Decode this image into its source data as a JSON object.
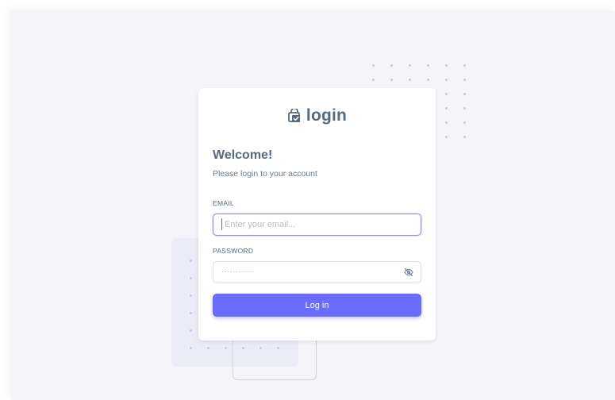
{
  "brand": {
    "name": "login",
    "icon": "shopping-bag-check-icon"
  },
  "heading": {
    "title": "Welcome!",
    "subtitle": "Please login to your account"
  },
  "form": {
    "email": {
      "label": "EMAIL",
      "value": "",
      "placeholder": "Enter your email..."
    },
    "password": {
      "label": "PASSWORD",
      "masked_value": "············",
      "toggle_icon": "eye-off-icon"
    },
    "submit_label": "Log in"
  },
  "colors": {
    "primary": "#696cff",
    "heading": "#566a7f",
    "text": "#697a8d",
    "background": "#f5f5f9",
    "card": "#ffffff",
    "focus_border": "#8e87ff"
  }
}
